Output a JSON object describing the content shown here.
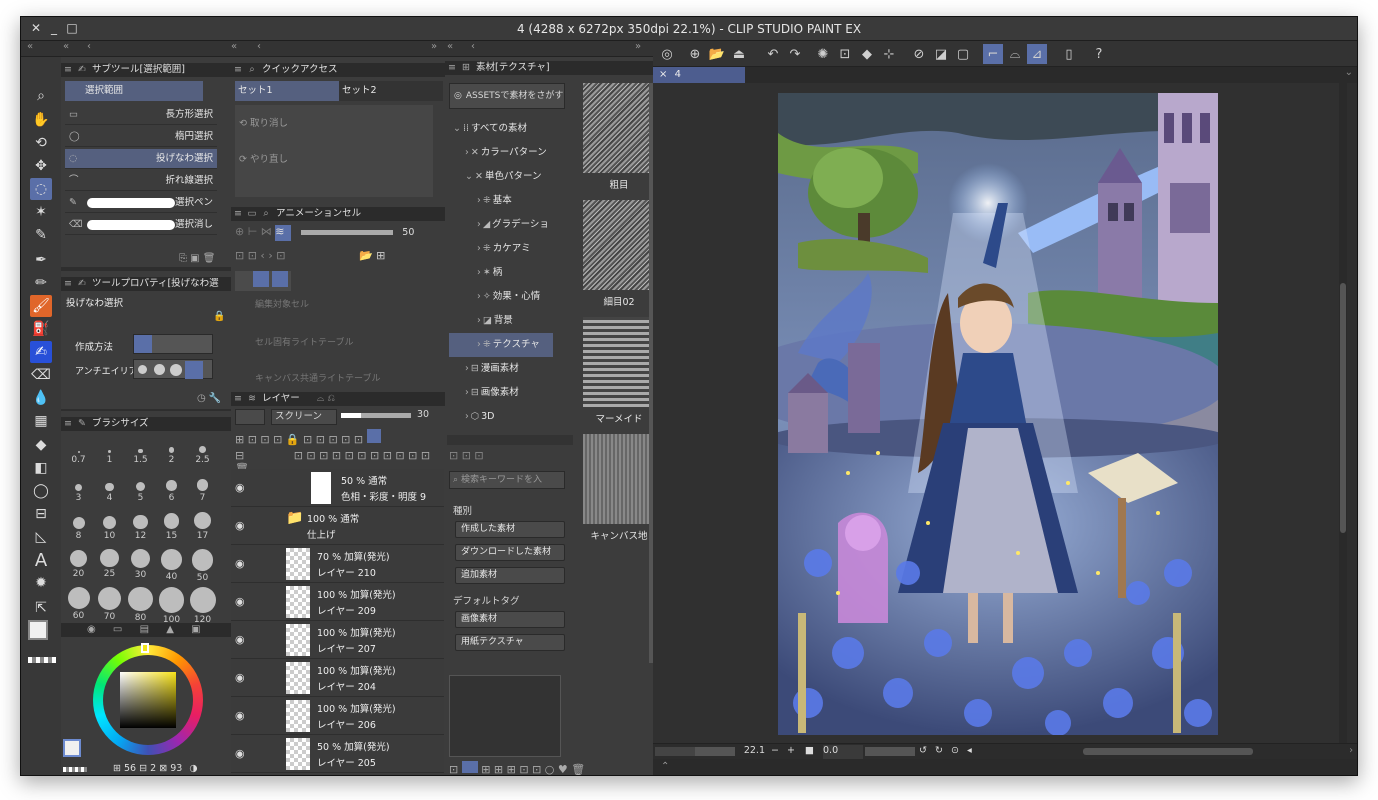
{
  "window": {
    "title": "4 (4288 x 6272px 350dpi 22.1%)  - CLIP STUDIO PAINT EX",
    "close": "✕",
    "minimize": "_",
    "maximize": "□"
  },
  "canvas_tab": {
    "close": "×",
    "label": "4"
  },
  "subtool": {
    "header": "サブツール[選択範囲]",
    "group_name": "選択範囲",
    "items": [
      "長方形選択",
      "楕円選択",
      "投げなわ選択",
      "折れ線選択",
      "選択ペン",
      "選択消し"
    ],
    "selected_index": 2
  },
  "tool_property": {
    "header": "ツールプロパティ[投げなわ選",
    "name": "投げなわ選択",
    "method_label": "作成方法",
    "antialias_label": "アンチエイリア"
  },
  "brush_size": {
    "header": "ブラシサイズ",
    "sizes": [
      "0.7",
      "1",
      "1.5",
      "2",
      "2.5",
      "3",
      "4",
      "5",
      "6",
      "7",
      "8",
      "10",
      "12",
      "15",
      "17",
      "20",
      "25",
      "30",
      "40",
      "50",
      "60",
      "70",
      "80",
      "100",
      "120"
    ]
  },
  "color": {
    "status": "56",
    "status2": "2",
    "status3": "93",
    "accent": "#5a6fa8"
  },
  "quick_access": {
    "header": "クイックアクセス",
    "tabs": [
      "セット1",
      "セット2"
    ],
    "items": [
      "取り消し",
      "やり直し"
    ]
  },
  "animation": {
    "header": "アニメーションセル",
    "value": "50",
    "edit_cell": "編集対象セル",
    "cell_lighttable": "セル固有ライトテーブル",
    "canvas_lighttable": "キャンバス共通ライトテーブル"
  },
  "layers": {
    "header": "レイヤー",
    "blend_mode": "スクリーン",
    "opacity": "30",
    "items": [
      {
        "line1": "50 % 通常",
        "line2": "色相・彩度・明度 9"
      },
      {
        "line1": "100 % 通常",
        "line2": "仕上げ"
      },
      {
        "line1": "70 % 加算(発光)",
        "line2": "レイヤー 210"
      },
      {
        "line1": "100 % 加算(発光)",
        "line2": "レイヤー 209"
      },
      {
        "line1": "100 % 加算(発光)",
        "line2": "レイヤー 207"
      },
      {
        "line1": "100 % 加算(発光)",
        "line2": "レイヤー 204"
      },
      {
        "line1": "100 % 加算(発光)",
        "line2": "レイヤー 206"
      },
      {
        "line1": "50 % 加算(発光)",
        "line2": "レイヤー 205"
      }
    ]
  },
  "material": {
    "header": "素材[テクスチャ]",
    "assets_search": "ASSETSで素材をさがす",
    "tree": [
      {
        "label": "すべての素材",
        "indent": 0
      },
      {
        "label": "カラーパターン",
        "indent": 1
      },
      {
        "label": "単色パターン",
        "indent": 1
      },
      {
        "label": "基本",
        "indent": 2
      },
      {
        "label": "グラデーショ",
        "indent": 2
      },
      {
        "label": "カケアミ",
        "indent": 2
      },
      {
        "label": "柄",
        "indent": 2
      },
      {
        "label": "効果・心情",
        "indent": 2
      },
      {
        "label": "背景",
        "indent": 2
      },
      {
        "label": "テクスチャ",
        "indent": 2
      },
      {
        "label": "漫画素材",
        "indent": 1
      },
      {
        "label": "画像素材",
        "indent": 1
      },
      {
        "label": "3D",
        "indent": 1
      }
    ],
    "selected_index": 9,
    "search_placeholder": "検索キーワードを入",
    "kind_label": "種別",
    "kind_buttons": [
      "作成した素材",
      "ダウンロードした素材",
      "追加素材"
    ],
    "default_tag_label": "デフォルトタグ",
    "tag_buttons": [
      "画像素材",
      "用紙テクスチャ"
    ],
    "textures": [
      "粗目",
      "細目02",
      "マーメイド",
      "キャンバス地"
    ]
  },
  "navigator": {
    "zoom": "22.1",
    "minus": "−",
    "plus": "+",
    "rotation": "0.0"
  }
}
